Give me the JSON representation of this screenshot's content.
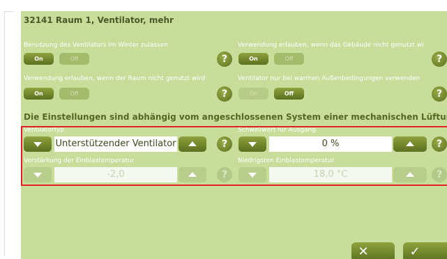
{
  "dialog": {
    "title": "32141 Raum 1, Ventilator, mehr"
  },
  "options": [
    {
      "label": "Benutzung des Ventilators im Winter zulassen",
      "on": "On",
      "off": "Off",
      "help": "?"
    },
    {
      "label": "Verwendung erlauben, wenn das Gebäude nicht genutzt wi",
      "on": "On",
      "off": "Off",
      "help": "?"
    },
    {
      "label": "Verwendung erlauben, wenn der Raum nicht genutzt wird",
      "on": "On",
      "off": "Off",
      "help": "?"
    },
    {
      "label": "Ventilator nur bei warmen Außenbedingungen verwenden",
      "on": "On",
      "off": "Off",
      "help": "?"
    }
  ],
  "section": {
    "title": "Die Einstellungen sind abhängig vom angeschlossenen System einer mechanischen Lüftung"
  },
  "fields": [
    {
      "label": "Ventilatortyp",
      "value": "Unterstützender Ventilator",
      "help": "?"
    },
    {
      "label": "Schwellwert für Ausgang",
      "value": "0 %",
      "help": "?"
    },
    {
      "label": "Verstärkung der Einblastemperatur",
      "value": "-2,0",
      "help": "?"
    },
    {
      "label": "Niedrigsten Einblastemperatur",
      "value": "18,0 °C",
      "help": "?"
    }
  ],
  "actions": {
    "cancel_glyph": "✕",
    "confirm_glyph": "✓"
  },
  "colors": {
    "panel": "#c8dd9a",
    "button": "#6f8529",
    "highlight": "#e01f27"
  }
}
